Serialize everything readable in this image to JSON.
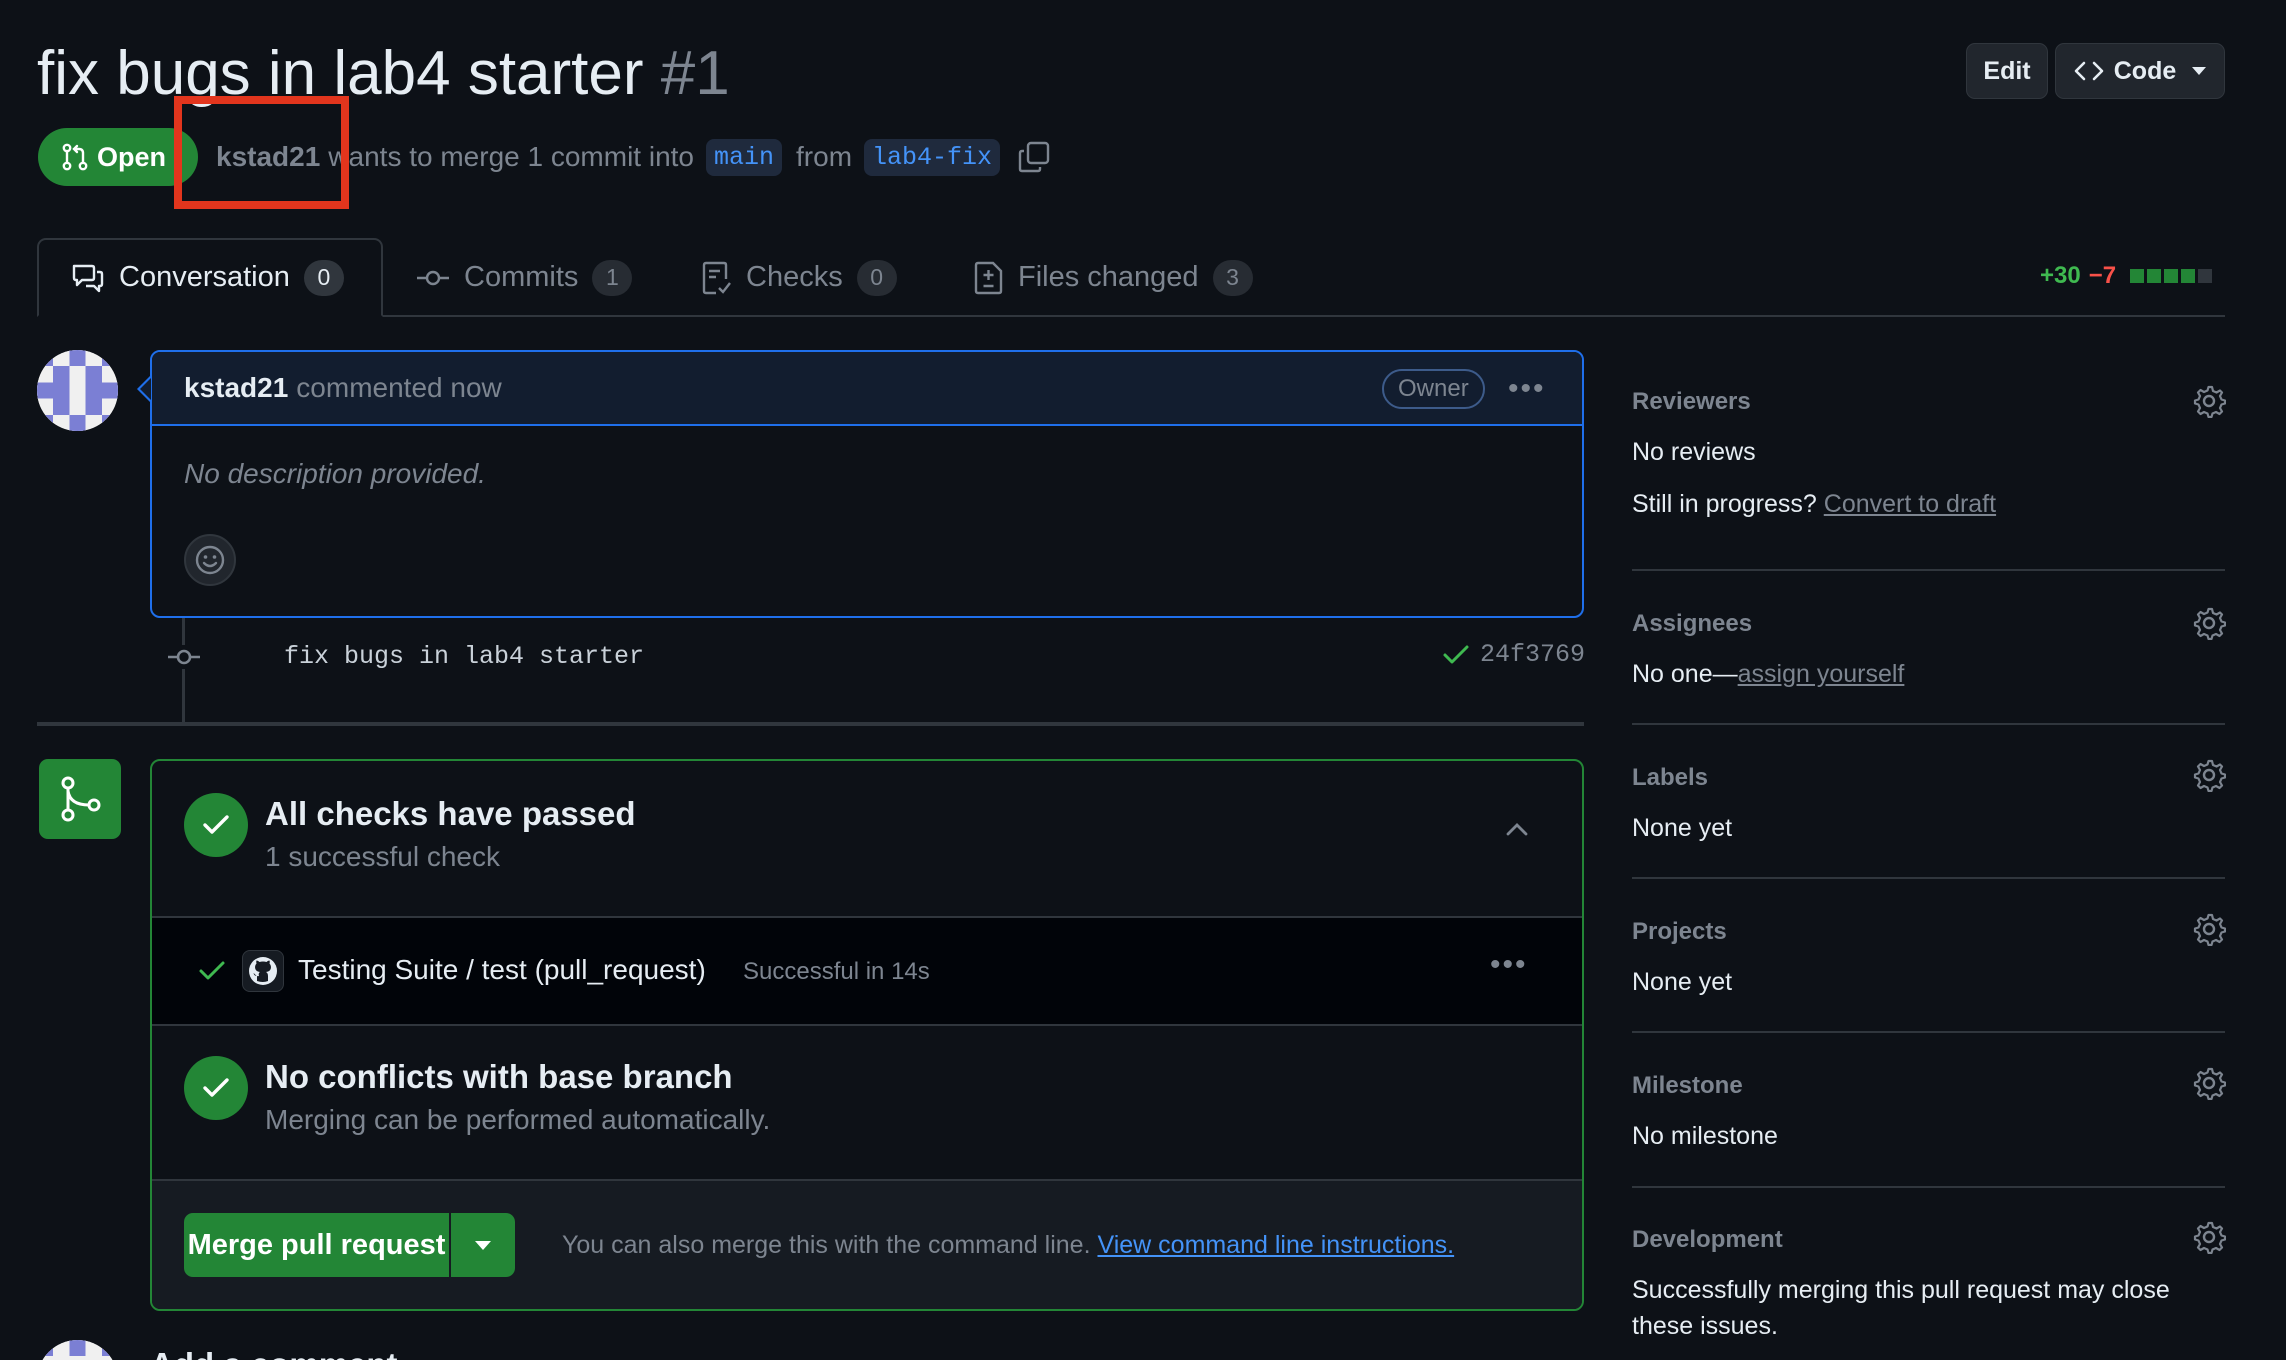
{
  "header": {
    "title": "fix bugs in lab4 starter",
    "number": "#1",
    "edit_label": "Edit",
    "code_label": "Code"
  },
  "pr_meta": {
    "state": "Open",
    "author": "kstad21",
    "text_mid": "wants to merge 1 commit into",
    "base_branch": "main",
    "text_from": "from",
    "head_branch": "lab4-fix"
  },
  "tabs": [
    {
      "label": "Conversation",
      "count": "0"
    },
    {
      "label": "Commits",
      "count": "1"
    },
    {
      "label": "Checks",
      "count": "0"
    },
    {
      "label": "Files changed",
      "count": "3"
    }
  ],
  "diffstat": {
    "additions": "+30",
    "deletions": "−7"
  },
  "comment": {
    "author": "kstad21",
    "action": "commented now",
    "badge": "Owner",
    "body": "No description provided."
  },
  "commit": {
    "message": "fix bugs in lab4 starter",
    "sha": "24f3769"
  },
  "mergebox": {
    "checks_title": "All checks have passed",
    "checks_sub": "1 successful check",
    "check_name": "Testing Suite / test (pull_request)",
    "check_status": "Successful in 14s",
    "conflicts_title": "No conflicts with base branch",
    "conflicts_sub": "Merging can be performed automatically.",
    "merge_label": "Merge pull request",
    "note": "You can also merge this with the command line.",
    "note_link": "View command line instructions."
  },
  "sidebar": {
    "reviewers": {
      "heading": "Reviewers",
      "value": "No reviews",
      "extra": "Still in progress?",
      "extra_link": "Convert to draft"
    },
    "assignees": {
      "heading": "Assignees",
      "value": "No one—",
      "link": "assign yourself"
    },
    "labels": {
      "heading": "Labels",
      "value": "None yet"
    },
    "projects": {
      "heading": "Projects",
      "value": "None yet"
    },
    "milestone": {
      "heading": "Milestone",
      "value": "No milestone"
    },
    "development": {
      "heading": "Development",
      "line1": "Successfully merging this pull request may close",
      "line2": "these issues."
    }
  },
  "footer": {
    "add_comment": "Add a comment"
  },
  "colors": {
    "success": "#238636",
    "accent": "#1f6feb",
    "link": "#4493f8",
    "highlight": "#e2351d"
  }
}
